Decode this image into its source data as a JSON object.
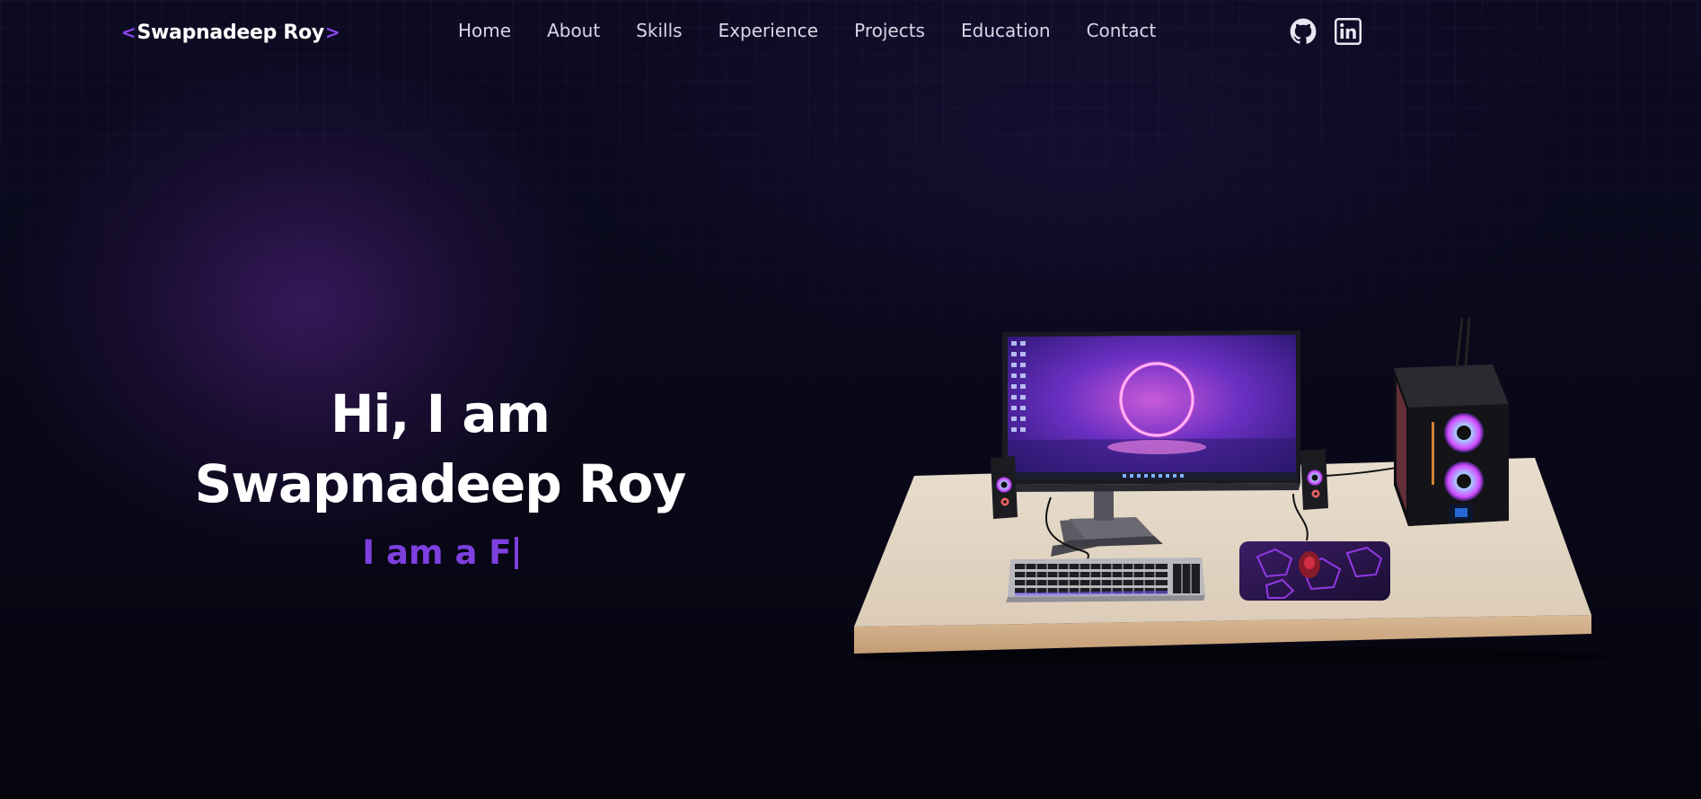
{
  "header": {
    "logo_open": "<",
    "logo_name": "Swapnadeep Roy",
    "logo_close": ">",
    "nav": [
      {
        "label": "Home"
      },
      {
        "label": "About"
      },
      {
        "label": "Skills"
      },
      {
        "label": "Experience"
      },
      {
        "label": "Projects"
      },
      {
        "label": "Education"
      },
      {
        "label": "Contact"
      }
    ],
    "socials": [
      {
        "icon": "github-icon"
      },
      {
        "icon": "linkedin-icon"
      }
    ]
  },
  "hero": {
    "greeting": "Hi, I am",
    "name": "Swapnadeep Roy",
    "role_typed": "I am a F"
  },
  "scene": {
    "description_icon": "desk-setup-illustration"
  },
  "colors": {
    "accent": "#7d3fe0",
    "background": "#07061a",
    "text": "#ffffff",
    "nav_text": "#d9d6e6"
  }
}
